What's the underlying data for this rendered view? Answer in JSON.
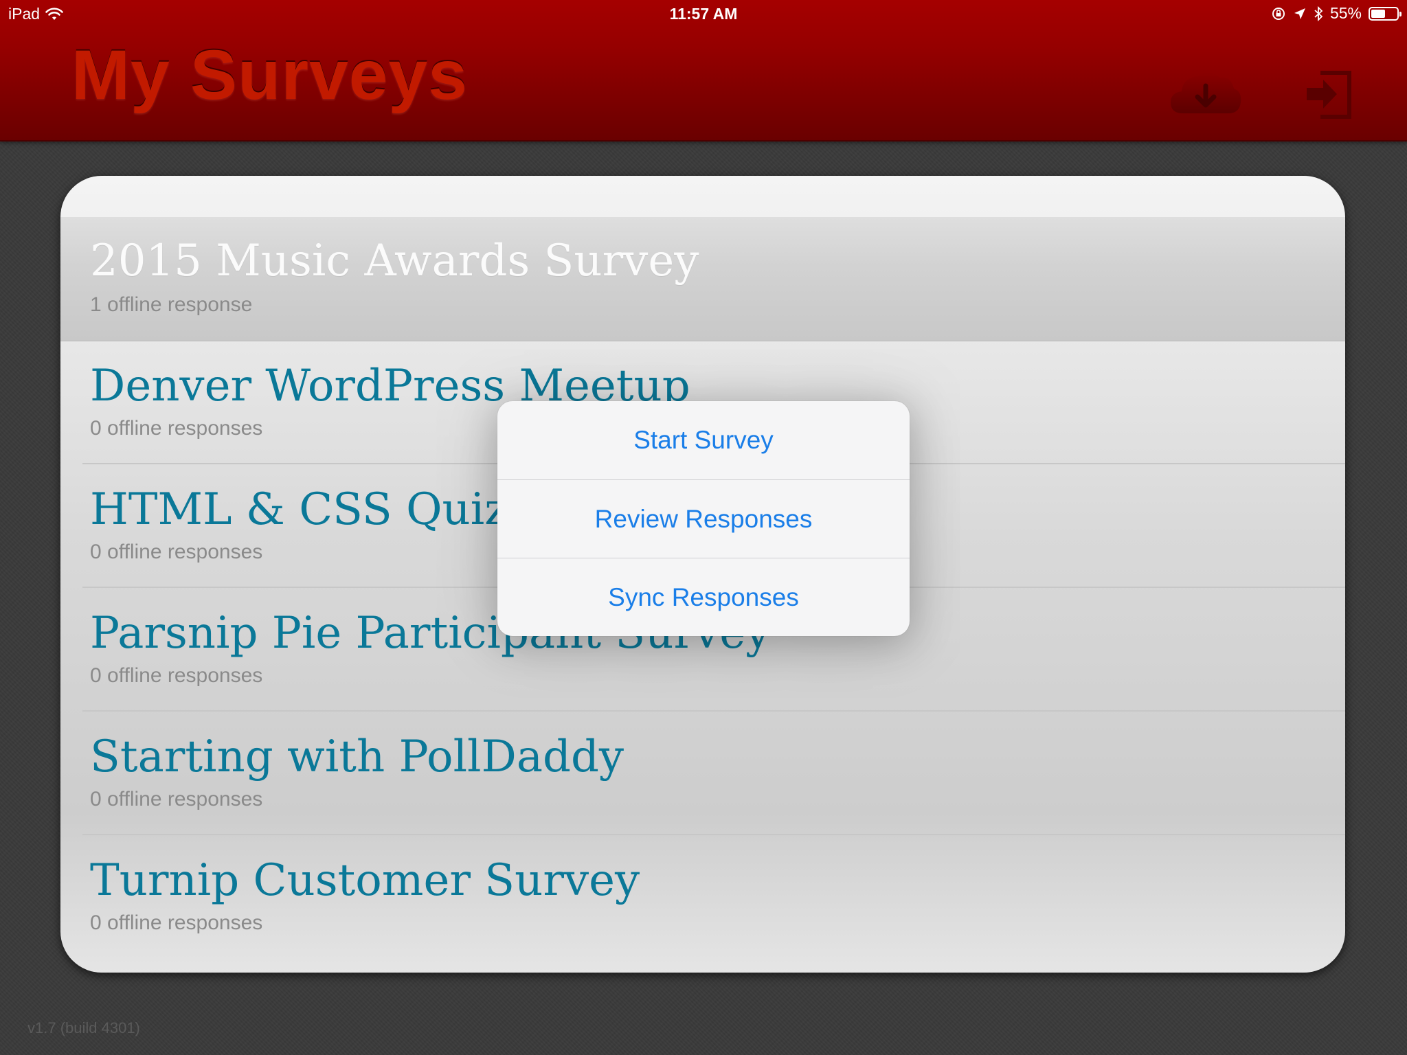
{
  "status_bar": {
    "carrier": "iPad",
    "time": "11:57 AM",
    "battery_percent": "55%",
    "battery_level": 0.55,
    "icons": [
      "wifi-icon",
      "orientation-lock-icon",
      "location-arrow-icon",
      "bluetooth-icon",
      "battery-icon"
    ]
  },
  "header": {
    "title": "My Surveys",
    "title_color": "#c21a00",
    "background_color": "#950000",
    "actions": [
      {
        "icon": "cloud-download-icon"
      },
      {
        "icon": "sign-out-icon"
      }
    ]
  },
  "surveys": [
    {
      "title": "2015 Music Awards Survey",
      "subtitle": "1 offline response",
      "selected": true
    },
    {
      "title": "Denver WordPress Meetup",
      "subtitle": "0 offline responses",
      "selected": false
    },
    {
      "title": "HTML & CSS Quiz",
      "subtitle": "0 offline responses",
      "selected": false
    },
    {
      "title": "Parsnip Pie Participant Survey",
      "subtitle": "0 offline responses",
      "selected": false
    },
    {
      "title": "Starting with PollDaddy",
      "subtitle": "0 offline responses",
      "selected": false
    },
    {
      "title": "Turnip Customer Survey",
      "subtitle": "0 offline responses",
      "selected": false
    }
  ],
  "popover": {
    "items": [
      {
        "label": "Start Survey"
      },
      {
        "label": "Review Responses"
      },
      {
        "label": "Sync Responses"
      }
    ],
    "text_color": "#1a7ee8"
  },
  "footer": {
    "version": "v1.7 (build 4301)"
  },
  "colors": {
    "survey_title": "#0a7898",
    "subtitle": "#8a8a8a"
  }
}
